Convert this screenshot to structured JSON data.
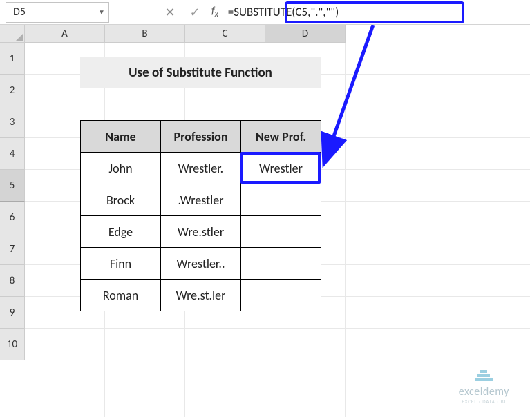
{
  "nameBox": {
    "value": "D5"
  },
  "formulaBar": {
    "value": "=SUBSTITUTE(C5,\".\",\"\")"
  },
  "columns": [
    "A",
    "B",
    "C",
    "D"
  ],
  "rows": [
    "1",
    "2",
    "3",
    "4",
    "5",
    "6",
    "7",
    "8",
    "9",
    "10"
  ],
  "activeCol": "D",
  "activeRow": "5",
  "title": "Use of Substitute Function",
  "table": {
    "headers": [
      "Name",
      "Profession",
      "New Prof."
    ],
    "rows": [
      {
        "name": "John",
        "profession": "Wrestler.",
        "newprof": "Wrestler"
      },
      {
        "name": "Brock",
        "profession": ".Wrestler",
        "newprof": ""
      },
      {
        "name": "Edge",
        "profession": "Wre.stler",
        "newprof": ""
      },
      {
        "name": "Finn",
        "profession": "Wrestler..",
        "newprof": ""
      },
      {
        "name": "Roman",
        "profession": "Wre.st.ler",
        "newprof": ""
      }
    ]
  },
  "watermark": {
    "name": "exceldemy",
    "tagline": "EXCEL · DATA · BI"
  },
  "chart_data": {
    "type": "table",
    "title": "Use of Substitute Function",
    "columns": [
      "Name",
      "Profession",
      "New Prof."
    ],
    "rows": [
      [
        "John",
        "Wrestler.",
        "Wrestler"
      ],
      [
        "Brock",
        ".Wrestler",
        ""
      ],
      [
        "Edge",
        "Wre.stler",
        ""
      ],
      [
        "Finn",
        "Wrestler..",
        ""
      ],
      [
        "Roman",
        "Wre.st.ler",
        ""
      ]
    ],
    "formula_cell": "D5",
    "formula": "=SUBSTITUTE(C5,\".\",\"\")"
  }
}
